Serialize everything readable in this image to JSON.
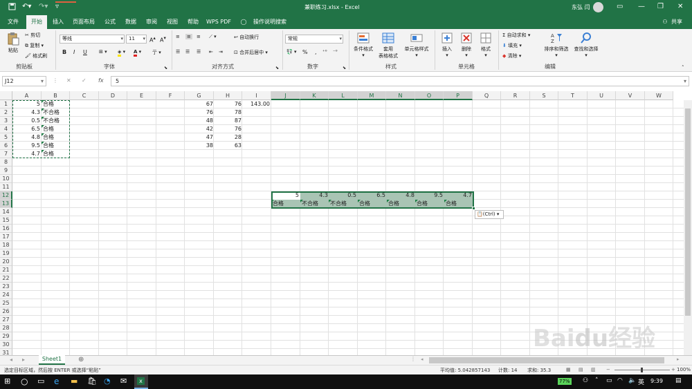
{
  "window": {
    "title": "兼职练习.xlsx - Excel",
    "user": "东弘 闫"
  },
  "tabs": [
    "文件",
    "开始",
    "插入",
    "页面布局",
    "公式",
    "数据",
    "审阅",
    "视图",
    "帮助",
    "WPS PDF"
  ],
  "tell_me": "操作说明搜索",
  "share": "共享",
  "ribbon": {
    "clipboard": {
      "paste": "粘贴",
      "cut": "剪切",
      "copy": "复制",
      "format_painter": "格式刷",
      "label": "剪贴板"
    },
    "font": {
      "name": "等线",
      "size": "11",
      "bold": "B",
      "italic": "I",
      "underline": "U",
      "label": "字体"
    },
    "alignment": {
      "wrap": "自动换行",
      "merge": "合并后居中",
      "label": "对齐方式"
    },
    "number": {
      "format": "常规",
      "percent": "%",
      "comma": ",",
      "label": "数字"
    },
    "styles": {
      "conditional": "条件格式",
      "table_fmt_1": "套用",
      "table_fmt_2": "表格格式",
      "cell_styles": "单元格样式",
      "label": "样式"
    },
    "cells": {
      "insert": "插入",
      "delete": "删除",
      "format": "格式",
      "label": "单元格"
    },
    "editing": {
      "autosum": "自动求和",
      "fill": "填充",
      "clear": "清除",
      "sort_filter": "排序和筛选",
      "find_select": "查找和选择",
      "label": "编辑"
    }
  },
  "formula_bar": {
    "name_box": "J12",
    "fx": "fx",
    "value": "5"
  },
  "columns": [
    "A",
    "B",
    "C",
    "D",
    "E",
    "F",
    "G",
    "H",
    "I",
    "J",
    "K",
    "L",
    "M",
    "N",
    "O",
    "P",
    "Q",
    "R",
    "S",
    "T",
    "U",
    "V",
    "W"
  ],
  "rows": [
    "1",
    "2",
    "3",
    "4",
    "5",
    "6",
    "7",
    "8",
    "9",
    "10",
    "11",
    "12",
    "13",
    "14",
    "15",
    "16",
    "17",
    "18",
    "19",
    "20",
    "21",
    "22",
    "23",
    "24",
    "25",
    "26",
    "27",
    "28",
    "29",
    "30",
    "31"
  ],
  "data": {
    "colA": [
      "5",
      "4.3",
      "0.5",
      "6.5",
      "4.8",
      "9.5",
      "4.7"
    ],
    "colB": [
      "合格",
      "不合格",
      "不合格",
      "合格",
      "合格",
      "合格",
      "合格"
    ],
    "colG": [
      "67",
      "76",
      "48",
      "42",
      "47",
      "38"
    ],
    "colH": [
      "76",
      "78",
      "87",
      "76",
      "28",
      "63"
    ],
    "i1": "143.00",
    "row12": [
      "5",
      "4.3",
      "0.5",
      "6.5",
      "4.8",
      "9.5",
      "4.7"
    ],
    "row13": [
      "合格",
      "不合格",
      "不合格",
      "合格",
      "合格",
      "合格",
      "合格"
    ]
  },
  "paste_options": "(Ctrl)",
  "sheet": {
    "name": "Sheet1"
  },
  "status": {
    "message": "选定目标区域，然后按 ENTER 或选择“粘贴”",
    "average": "平均值: 5.042857143",
    "count": "计数: 14",
    "sum": "求和: 35.3",
    "zoom": "100%"
  },
  "taskbar": {
    "battery": "77%",
    "time": "9:39"
  },
  "colors": {
    "excel_green": "#217346",
    "selection": "#217346",
    "selected_fill": "#a9c4b4"
  }
}
